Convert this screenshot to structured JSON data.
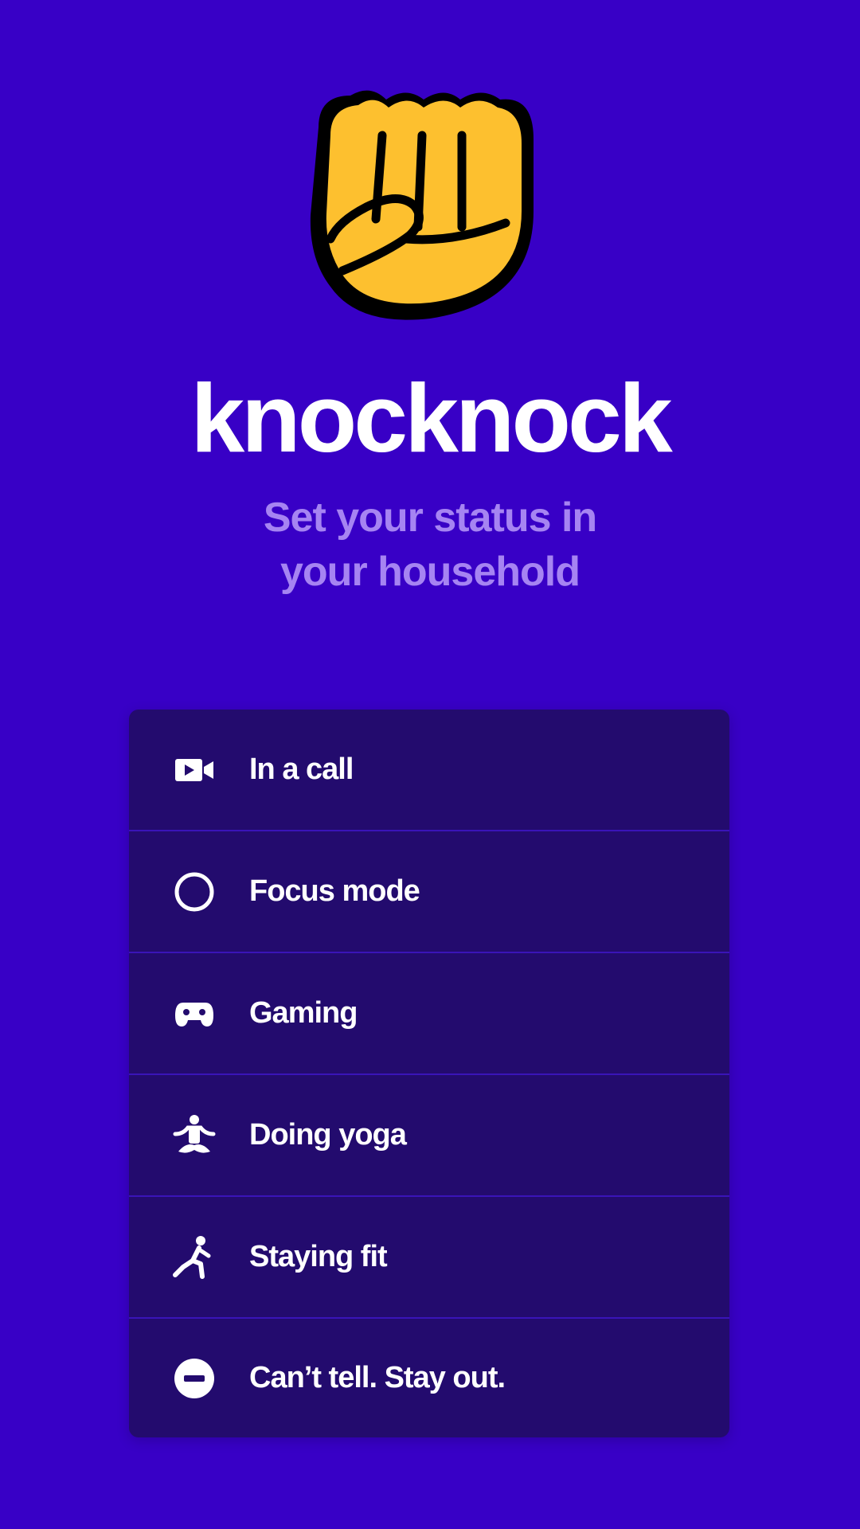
{
  "app": {
    "name": "knocknock",
    "tagline_line1": "Set your status in",
    "tagline_line2": "your household"
  },
  "colors": {
    "background": "#3800c6",
    "list_background": "#230b6e",
    "divider": "#3a14b8",
    "logo_yellow": "#fdc02f",
    "tagline": "#a684f2"
  },
  "statuses": [
    {
      "label": "In a call",
      "icon": "video-camera-icon"
    },
    {
      "label": "Focus mode",
      "icon": "circle-icon"
    },
    {
      "label": "Gaming",
      "icon": "gamepad-icon"
    },
    {
      "label": "Doing yoga",
      "icon": "yoga-icon"
    },
    {
      "label": "Staying fit",
      "icon": "exercise-icon"
    },
    {
      "label": "Can’t tell. Stay out.",
      "icon": "do-not-enter-icon"
    }
  ]
}
